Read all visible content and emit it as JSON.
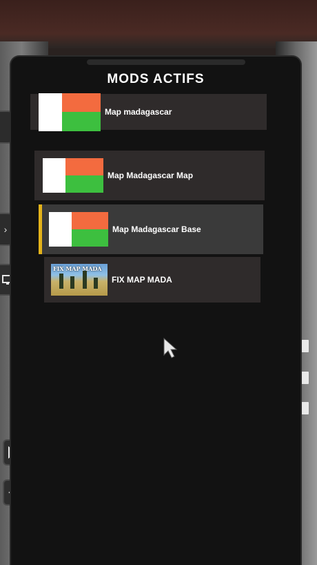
{
  "panel": {
    "title": "MODS ACTIFS"
  },
  "mods": [
    {
      "name": "Map madagascar",
      "thumbnail": "madagascar-flag"
    },
    {
      "name": "Map Madagascar Map",
      "thumbnail": "madagascar-flag"
    },
    {
      "name": "Map Madagascar Base",
      "thumbnail": "madagascar-flag",
      "selected": true
    },
    {
      "name": "FIX MAP MADA",
      "thumbnail": "fix-map-mada-photo",
      "thumbnail_caption": "FIX MAP MADA"
    }
  ],
  "side_controls": {
    "forward_icon": "fast-forward-icon",
    "rewind_icon": "rewind-icon"
  },
  "colors": {
    "panel_bg": "#121212",
    "row_bg": "#2f2b2b",
    "selected_accent": "#e4b31a",
    "flag_white": "#ffffff",
    "flag_red": "#f36b3f",
    "flag_green": "#3dbf3f"
  }
}
